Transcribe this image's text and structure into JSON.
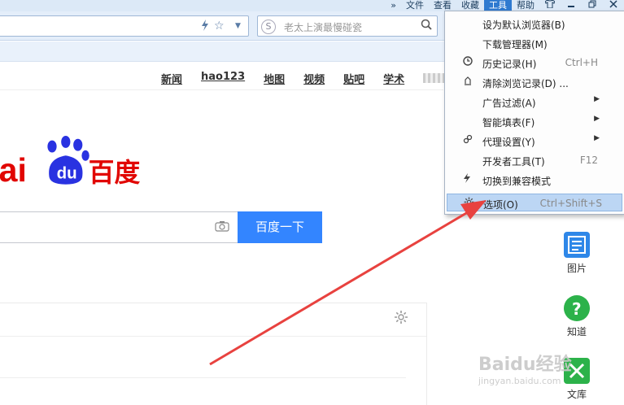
{
  "menubar": {
    "chevron": "»",
    "items": [
      "文件",
      "查看",
      "收藏",
      "工具",
      "帮助"
    ],
    "active_index": 3
  },
  "window_controls": [
    "shirt-icon",
    "minimize-icon",
    "restore-icon",
    "close-icon"
  ],
  "search_bar": {
    "placeholder": "老太上演最慢碰瓷",
    "engine_icon": "S"
  },
  "baidu": {
    "nav": [
      "新闻",
      "hao123",
      "地图",
      "视频",
      "贴吧",
      "学术"
    ],
    "logo_text": "百度",
    "logo_du": "du",
    "logo_prefix": "ai",
    "search_button": "百度一下"
  },
  "right_sidebar": [
    {
      "label": "图片",
      "icon": "image-icon",
      "color": "#2e87e8"
    },
    {
      "label": "知道",
      "icon": "question-icon",
      "color": "#2cb24a"
    },
    {
      "label": "文库",
      "icon": "doc-icon",
      "color": "#2cb24a"
    }
  ],
  "dropdown": {
    "items": [
      {
        "label": "设为默认浏览器(B)",
        "shortcut": "",
        "icon": "",
        "submenu": false
      },
      {
        "label": "下载管理器(M)",
        "shortcut": "",
        "icon": "",
        "submenu": false
      },
      {
        "label": "历史记录(H)",
        "shortcut": "Ctrl+H",
        "icon": "clock-icon",
        "submenu": false
      },
      {
        "label": "清除浏览记录(D) ...",
        "shortcut": "",
        "icon": "eraser-icon",
        "submenu": false
      },
      {
        "label": "广告过滤(A)",
        "shortcut": "",
        "icon": "",
        "submenu": true
      },
      {
        "label": "智能填表(F)",
        "shortcut": "",
        "icon": "",
        "submenu": true
      },
      {
        "label": "代理设置(Y)",
        "shortcut": "",
        "icon": "link-icon",
        "submenu": true
      },
      {
        "label": "开发者工具(T)",
        "shortcut": "F12",
        "icon": "",
        "submenu": false
      },
      {
        "label": "切换到兼容模式",
        "shortcut": "",
        "icon": "lightning-icon",
        "submenu": false
      },
      {
        "label": "选项(O)",
        "shortcut": "Ctrl+Shift+S",
        "icon": "gear-icon",
        "submenu": false,
        "highlighted": true
      }
    ]
  },
  "watermark": {
    "text": "Baidu经验",
    "sub": "jingyan.baidu.com"
  },
  "colors": {
    "accent": "#2f7ad0",
    "baidu_blue": "#3385ff",
    "baidu_red": "#e10602",
    "annotation": "#e8423f"
  }
}
